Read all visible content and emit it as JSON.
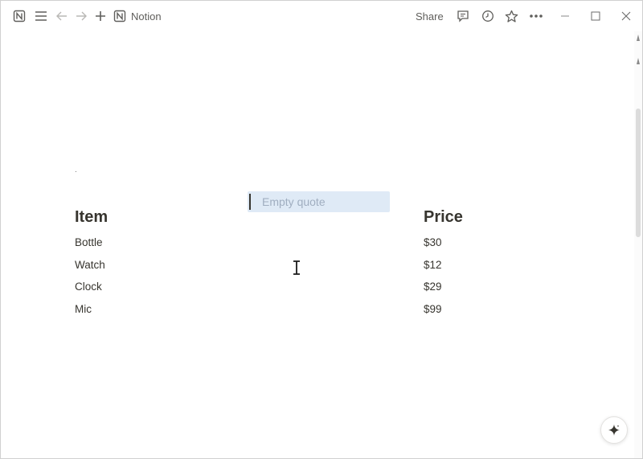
{
  "topbar": {
    "breadcrumb_label": "Notion",
    "share_label": "Share"
  },
  "content": {
    "dot": ".",
    "quote_placeholder": "Empty quote",
    "table": {
      "headers": [
        "Item",
        "Price"
      ],
      "rows": [
        {
          "item": "Bottle",
          "price": "$30"
        },
        {
          "item": "Watch",
          "price": "$12"
        },
        {
          "item": "Clock",
          "price": "$29"
        },
        {
          "item": "Mic",
          "price": "$99"
        }
      ]
    }
  },
  "icons": {
    "app": "notion-logo-icon",
    "menu": "hamburger-menu-icon",
    "back": "arrow-left-icon",
    "forward": "arrow-right-icon",
    "new": "plus-icon",
    "comment": "comment-icon",
    "history": "clock-icon",
    "favorite": "star-icon",
    "more": "more-dots-icon",
    "minimize": "minimize-icon",
    "maximize": "maximize-icon",
    "close": "close-icon",
    "ai": "sparkle-icon"
  },
  "colors": {
    "text": "#37352f",
    "muted": "#5f5e5b",
    "quote_bg": "#dfeaf6",
    "placeholder": "#a0aec0"
  }
}
